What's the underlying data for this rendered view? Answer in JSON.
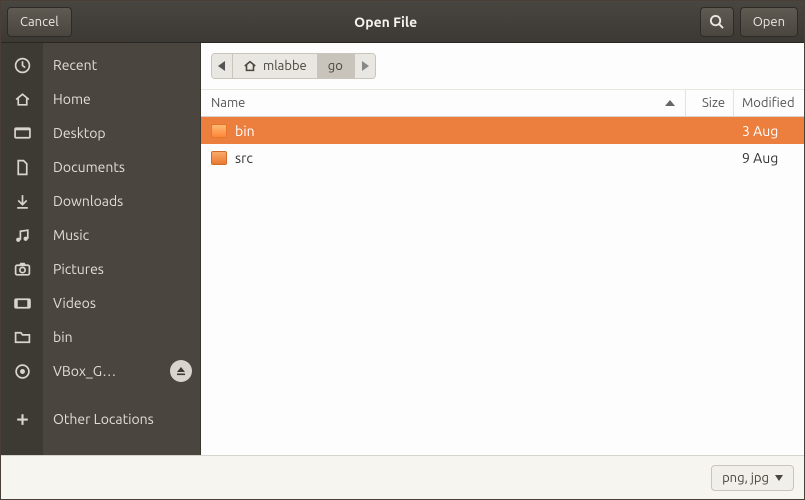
{
  "titlebar": {
    "cancel": "Cancel",
    "title": "Open File",
    "open": "Open"
  },
  "sidebar": {
    "items": [
      {
        "icon": "clock",
        "label": "Recent"
      },
      {
        "icon": "home",
        "label": "Home"
      },
      {
        "icon": "desktop",
        "label": "Desktop"
      },
      {
        "icon": "document",
        "label": "Documents"
      },
      {
        "icon": "download",
        "label": "Downloads"
      },
      {
        "icon": "music",
        "label": "Music"
      },
      {
        "icon": "camera",
        "label": "Pictures"
      },
      {
        "icon": "video",
        "label": "Videos"
      },
      {
        "icon": "folder",
        "label": "bin"
      },
      {
        "icon": "disc",
        "label": "VBox_G…",
        "eject": true
      },
      {
        "icon": "plus",
        "label": "Other Locations"
      }
    ]
  },
  "path": {
    "segments": [
      {
        "label": "mlabbe",
        "home": true
      },
      {
        "label": "go",
        "active": true
      }
    ]
  },
  "columns": {
    "name": "Name",
    "size": "Size",
    "modified": "Modified"
  },
  "files": [
    {
      "name": "bin",
      "size": "",
      "modified": "3 Aug",
      "selected": true
    },
    {
      "name": "src",
      "size": "",
      "modified": "9 Aug",
      "selected": false
    }
  ],
  "filter": {
    "label": "png, jpg"
  }
}
